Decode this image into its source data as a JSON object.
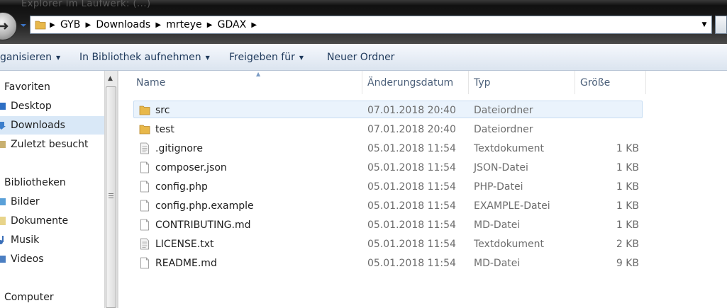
{
  "window": {
    "title": "Explorer im Laufwerk: (...)"
  },
  "address_bar": {
    "crumbs": [
      "GYB",
      "Downloads",
      "mrteye",
      "GDAX"
    ]
  },
  "toolbar": {
    "organize": "ganisieren",
    "library": "In Bibliothek aufnehmen",
    "share": "Freigeben für",
    "new_folder": "Neuer Ordner"
  },
  "nav": {
    "favorites": "Favoriten",
    "desktop": "Desktop",
    "downloads": "Downloads",
    "recent": "Zuletzt besucht",
    "libraries": "Bibliotheken",
    "pictures": "Bilder",
    "documents": "Dokumente",
    "music": "Musik",
    "videos": "Videos",
    "computer": "Computer"
  },
  "columns": {
    "name": "Name",
    "date": "Änderungsdatum",
    "type": "Typ",
    "size": "Größe"
  },
  "files": [
    {
      "name": "src",
      "date": "07.01.2018 20:40",
      "type": "Dateiordner",
      "size": "",
      "icon": "folder-icon"
    },
    {
      "name": "test",
      "date": "07.01.2018 20:40",
      "type": "Dateiordner",
      "size": "",
      "icon": "folder-icon"
    },
    {
      "name": ".gitignore",
      "date": "05.01.2018 11:54",
      "type": "Textdokument",
      "size": "1 KB",
      "icon": "text-file-icon"
    },
    {
      "name": "composer.json",
      "date": "05.01.2018 11:54",
      "type": "JSON-Datei",
      "size": "1 KB",
      "icon": "file-icon"
    },
    {
      "name": "config.php",
      "date": "05.01.2018 11:54",
      "type": "PHP-Datei",
      "size": "1 KB",
      "icon": "file-icon"
    },
    {
      "name": "config.php.example",
      "date": "05.01.2018 11:54",
      "type": "EXAMPLE-Datei",
      "size": "1 KB",
      "icon": "file-icon"
    },
    {
      "name": "CONTRIBUTING.md",
      "date": "05.01.2018 11:54",
      "type": "MD-Datei",
      "size": "1 KB",
      "icon": "file-icon"
    },
    {
      "name": "LICENSE.txt",
      "date": "05.01.2018 11:54",
      "type": "Textdokument",
      "size": "2 KB",
      "icon": "text-file-icon"
    },
    {
      "name": "README.md",
      "date": "05.01.2018 11:54",
      "type": "MD-Datei",
      "size": "9 KB",
      "icon": "file-icon"
    }
  ],
  "colors": {
    "selection": "#eaf3fc",
    "toolbar_text": "#1e395b",
    "folder": "#e8b84a"
  }
}
